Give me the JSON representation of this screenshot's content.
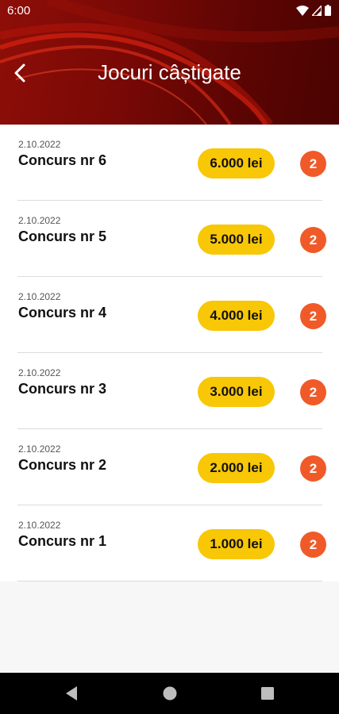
{
  "status_bar": {
    "time": "6:00",
    "icons": [
      "wifi-icon",
      "signal-icon",
      "battery-icon"
    ]
  },
  "header": {
    "title": "Jocuri câștigate",
    "back_icon": "back-arrow-icon"
  },
  "games": [
    {
      "date": "2.10.2022",
      "title": "Concurs nr 6",
      "prize": "6.000 lei",
      "count": "2"
    },
    {
      "date": "2.10.2022",
      "title": "Concurs nr 5",
      "prize": "5.000 lei",
      "count": "2"
    },
    {
      "date": "2.10.2022",
      "title": "Concurs nr 4",
      "prize": "4.000 lei",
      "count": "2"
    },
    {
      "date": "2.10.2022",
      "title": "Concurs nr 3",
      "prize": "3.000 lei",
      "count": "2"
    },
    {
      "date": "2.10.2022",
      "title": "Concurs nr 2",
      "prize": "2.000 lei",
      "count": "2"
    },
    {
      "date": "2.10.2022",
      "title": "Concurs nr 1",
      "prize": "1.000 lei",
      "count": "2"
    }
  ],
  "navbar": {
    "buttons": [
      "nav-back-icon",
      "nav-home-icon",
      "nav-recents-icon"
    ]
  },
  "colors": {
    "header_red": "#7a0906",
    "prize_yellow": "#f8c706",
    "count_orange": "#f05a28"
  }
}
